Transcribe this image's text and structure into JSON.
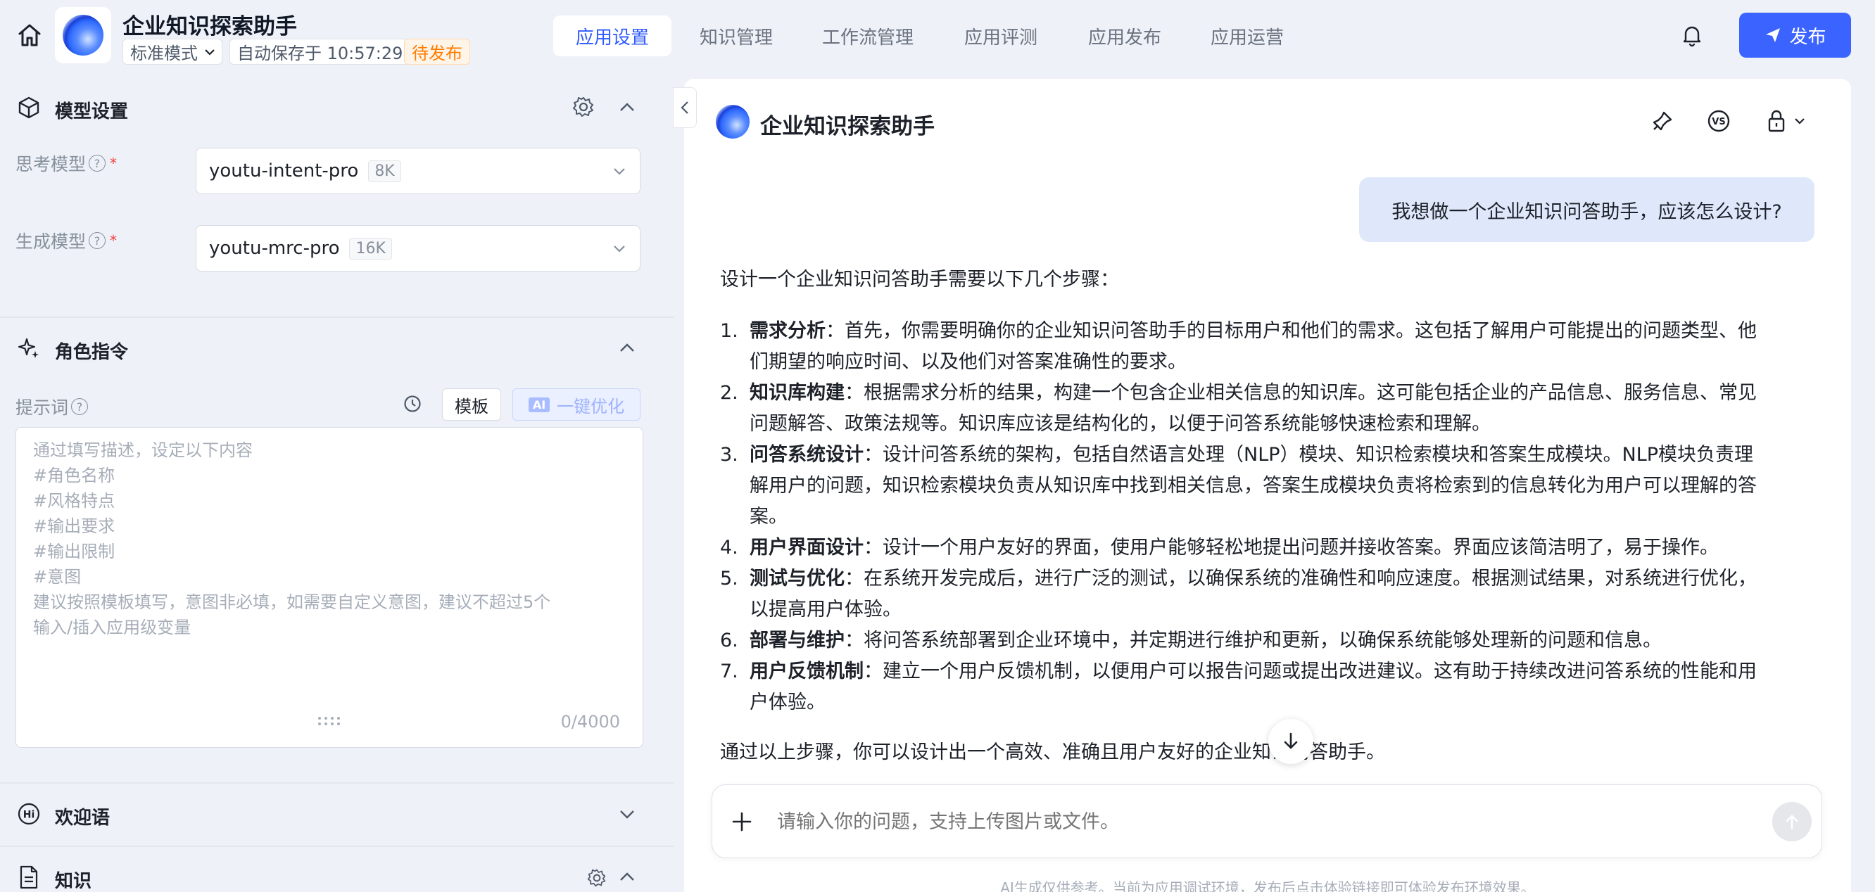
{
  "header": {
    "app_title": "企业知识探索助手",
    "mode_select": "标准模式",
    "autosave": "自动保存于 10:57:29",
    "status": "待发布",
    "tabs": [
      "应用设置",
      "知识管理",
      "工作流管理",
      "应用评测",
      "应用发布",
      "应用运营"
    ],
    "active_tab": "应用设置",
    "publish_label": "发布"
  },
  "model_settings": {
    "title": "模型设置",
    "thinking_model_label": "思考模型",
    "thinking_model_value": "youtu-intent-pro",
    "thinking_model_ctx": "8K",
    "gen_model_label": "生成模型",
    "gen_model_value": "youtu-mrc-pro",
    "gen_model_ctx": "16K"
  },
  "role": {
    "title": "角色指令",
    "prompt_label": "提示词",
    "template_btn": "模板",
    "ai_tag": "AI",
    "optimize_btn": "一键优化",
    "placeholder_lines": [
      "通过填写描述，设定以下内容",
      "#角色名称",
      "#风格特点",
      "#输出要求",
      "#输出限制",
      "#意图",
      "建议按照模板填写，意图非必填，如需要自定义意图，建议不超过5个",
      "输入/插入应用级变量"
    ],
    "counter": "0/4000"
  },
  "welcome": {
    "title": "欢迎语"
  },
  "knowledge": {
    "title": "知识"
  },
  "chat": {
    "title": "企业知识探索助手",
    "user_message": "我想做一个企业知识问答助手，应该怎么设计?",
    "answer_intro": "设计一个企业知识问答助手需要以下几个步骤：",
    "steps": [
      {
        "num": "1.",
        "bold": "需求分析",
        "lines": [
          "：首先，你需要明确你的企业知识问答助手的目标用户和他们的需求。这包括了解用户可能提出的问题类型、他",
          "们期望的响应时间、以及他们对答案准确性的要求。"
        ]
      },
      {
        "num": "2.",
        "bold": "知识库构建",
        "lines": [
          "：根据需求分析的结果，构建一个包含企业相关信息的知识库。这可能包括企业的产品信息、服务信息、常见",
          "问题解答、政策法规等。知识库应该是结构化的，以便于问答系统能够快速检索和理解。"
        ]
      },
      {
        "num": "3.",
        "bold": "问答系统设计",
        "lines": [
          "：设计问答系统的架构，包括自然语言处理（NLP）模块、知识检索模块和答案生成模块。NLP模块负责理",
          "解用户的问题，知识检索模块负责从知识库中找到相关信息，答案生成模块负责将检索到的信息转化为用户可以理解的答",
          "案。"
        ]
      },
      {
        "num": "4.",
        "bold": "用户界面设计",
        "lines": [
          "：设计一个用户友好的界面，使用户能够轻松地提出问题并接收答案。界面应该简洁明了，易于操作。"
        ]
      },
      {
        "num": "5.",
        "bold": "测试与优化",
        "lines": [
          "：在系统开发完成后，进行广泛的测试，以确保系统的准确性和响应速度。根据测试结果，对系统进行优化，",
          "以提高用户体验。"
        ]
      },
      {
        "num": "6.",
        "bold": "部署与维护",
        "lines": [
          "：将问答系统部署到企业环境中，并定期进行维护和更新，以确保系统能够处理新的问题和信息。"
        ]
      },
      {
        "num": "7.",
        "bold": "用户反馈机制",
        "lines": [
          "：建立一个用户反馈机制，以便用户可以报告问题或提出改进建议。这有助于持续改进问答系统的性能和用",
          "户体验。"
        ]
      }
    ],
    "answer_outro": "通过以上步骤，你可以设计出一个高效、准确且用户友好的企业知识问答助手。",
    "input_placeholder": "请输入你的问题，支持上传图片或文件。",
    "footer_note": "AI生成仅供参考。当前为应用调试环境，发布后点击体验链接即可体验发布环境效果。"
  },
  "colors": {
    "accent": "#3b63ff",
    "active_tab_text": "#2f5bff",
    "pending": "#ff7d00",
    "user_bubble": "#dfe8fb",
    "background": "#eef1f7"
  },
  "icons": [
    "home-icon",
    "app-logo",
    "chevron-down-icon",
    "bell-icon",
    "send-icon",
    "cube-icon",
    "gear-icon",
    "chevron-up-icon",
    "sparkle-icon",
    "history-icon",
    "hi-icon",
    "document-icon",
    "chevron-left-icon",
    "pin-icon",
    "vs-icon",
    "lock-icon",
    "arrow-down-icon",
    "plus-icon",
    "arrow-up-icon"
  ]
}
